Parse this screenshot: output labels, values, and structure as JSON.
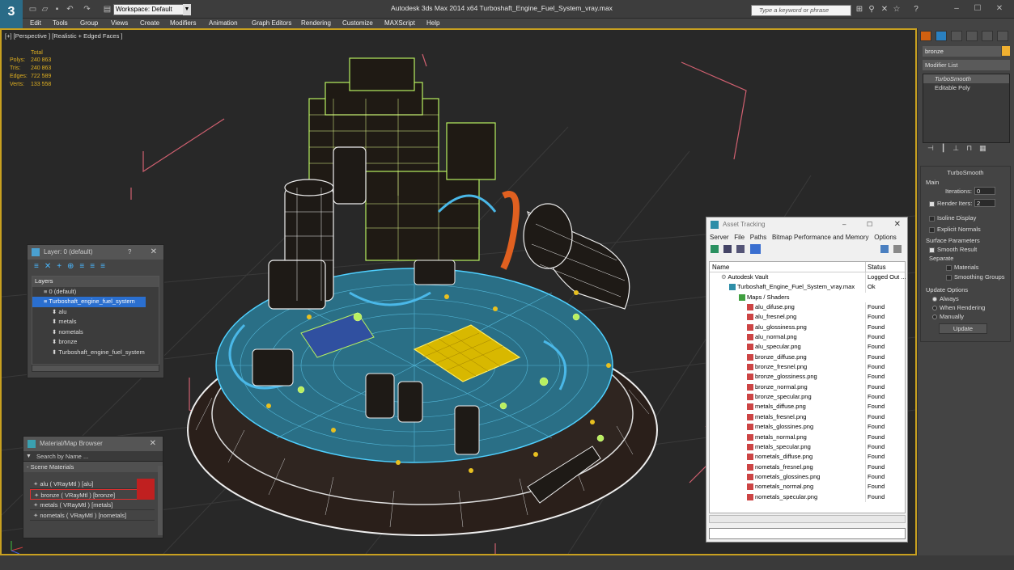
{
  "titlebar": {
    "app_logo": "3",
    "workspace": "Workspace: Default",
    "title": "Autodesk 3ds Max  2014 x64     Turboshaft_Engine_Fuel_System_vray.max",
    "search_placeholder": "Type a keyword or phrase"
  },
  "menu": [
    "Edit",
    "Tools",
    "Group",
    "Views",
    "Create",
    "Modifiers",
    "Animation",
    "Graph Editors",
    "Rendering",
    "Customize",
    "MAXScript",
    "Help"
  ],
  "viewport": {
    "label": "[+] [Perspective ] [Realistic + Edged Faces ]",
    "stats": {
      "header": "Total",
      "rows": [
        {
          "label": "Polys:",
          "value": "240 863"
        },
        {
          "label": "Tris:",
          "value": "240 863"
        },
        {
          "label": "Edges:",
          "value": "722 589"
        },
        {
          "label": "Verts:",
          "value": "133 558"
        }
      ]
    }
  },
  "layers": {
    "title": "Layer: 0 (default)",
    "help": "?",
    "header": "Layers",
    "rows": [
      "0 (default)",
      "Turboshaft_engine_fuel_system",
      "alu",
      "metals",
      "nometals",
      "bronze",
      "Turboshaft_engine_fuel_system"
    ]
  },
  "materials": {
    "title": "Material/Map Browser",
    "search_placeholder": "Search by Name ...",
    "section": "- Scene Materials",
    "items": [
      "alu  ( VRayMtl ) [alu]",
      "bronze  ( VRayMtl ) [bronze]",
      "metals  ( VRayMtl ) [metals]",
      "nometals  ( VRayMtl ) [nometals]"
    ]
  },
  "assets": {
    "title": "Asset Tracking",
    "menu": [
      "Server",
      "File",
      "Paths",
      "Bitmap Performance and Memory",
      "Options"
    ],
    "columns": {
      "name": "Name",
      "status": "Status"
    },
    "vault": {
      "name": "Autodesk Vault",
      "status": "Logged Out ..."
    },
    "file": {
      "name": "Turboshaft_Engine_Fuel_System_vray.max",
      "status": "Ok"
    },
    "maps_folder": "Maps / Shaders",
    "maps": [
      {
        "name": "alu_difuse.png",
        "status": "Found"
      },
      {
        "name": "alu_fresnel.png",
        "status": "Found"
      },
      {
        "name": "alu_glossiness.png",
        "status": "Found"
      },
      {
        "name": "alu_normal.png",
        "status": "Found"
      },
      {
        "name": "alu_specular.png",
        "status": "Found"
      },
      {
        "name": "bronze_diffuse.png",
        "status": "Found"
      },
      {
        "name": "bronze_fresnel.png",
        "status": "Found"
      },
      {
        "name": "bronze_glossiness.png",
        "status": "Found"
      },
      {
        "name": "bronze_normal.png",
        "status": "Found"
      },
      {
        "name": "bronze_specular.png",
        "status": "Found"
      },
      {
        "name": "metals_diffuse.png",
        "status": "Found"
      },
      {
        "name": "metals_fresnel.png",
        "status": "Found"
      },
      {
        "name": "metals_glossines.png",
        "status": "Found"
      },
      {
        "name": "metals_normal.png",
        "status": "Found"
      },
      {
        "name": "metals_specular.png",
        "status": "Found"
      },
      {
        "name": "nometals_diffuse.png",
        "status": "Found"
      },
      {
        "name": "nometals_fresnel.png",
        "status": "Found"
      },
      {
        "name": "nometals_glossines.png",
        "status": "Found"
      },
      {
        "name": "nometals_normal.png",
        "status": "Found"
      },
      {
        "name": "nometals_specular.png",
        "status": "Found"
      }
    ]
  },
  "command_panel": {
    "object_name": "bronze",
    "object_color": "#f0b030",
    "modifier_list": "Modifier List",
    "stack": [
      "TurboSmooth",
      "Editable Poly"
    ],
    "rollout_title": "TurboSmooth",
    "main_label": "Main",
    "iterations_label": "Iterations:",
    "iterations_value": "0",
    "render_iters_label": "Render Iters:",
    "render_iters_value": "2",
    "isoline": "Isoline Display",
    "explicit": "Explicit Normals",
    "surface_label": "Surface Parameters",
    "smooth_result": "Smooth Result",
    "separate_label": "Separate",
    "materials_cb": "Materials",
    "smoothing_cb": "Smoothing Groups",
    "update_label": "Update Options",
    "always": "Always",
    "when_rendering": "When Rendering",
    "manually": "Manually",
    "update_button": "Update"
  }
}
